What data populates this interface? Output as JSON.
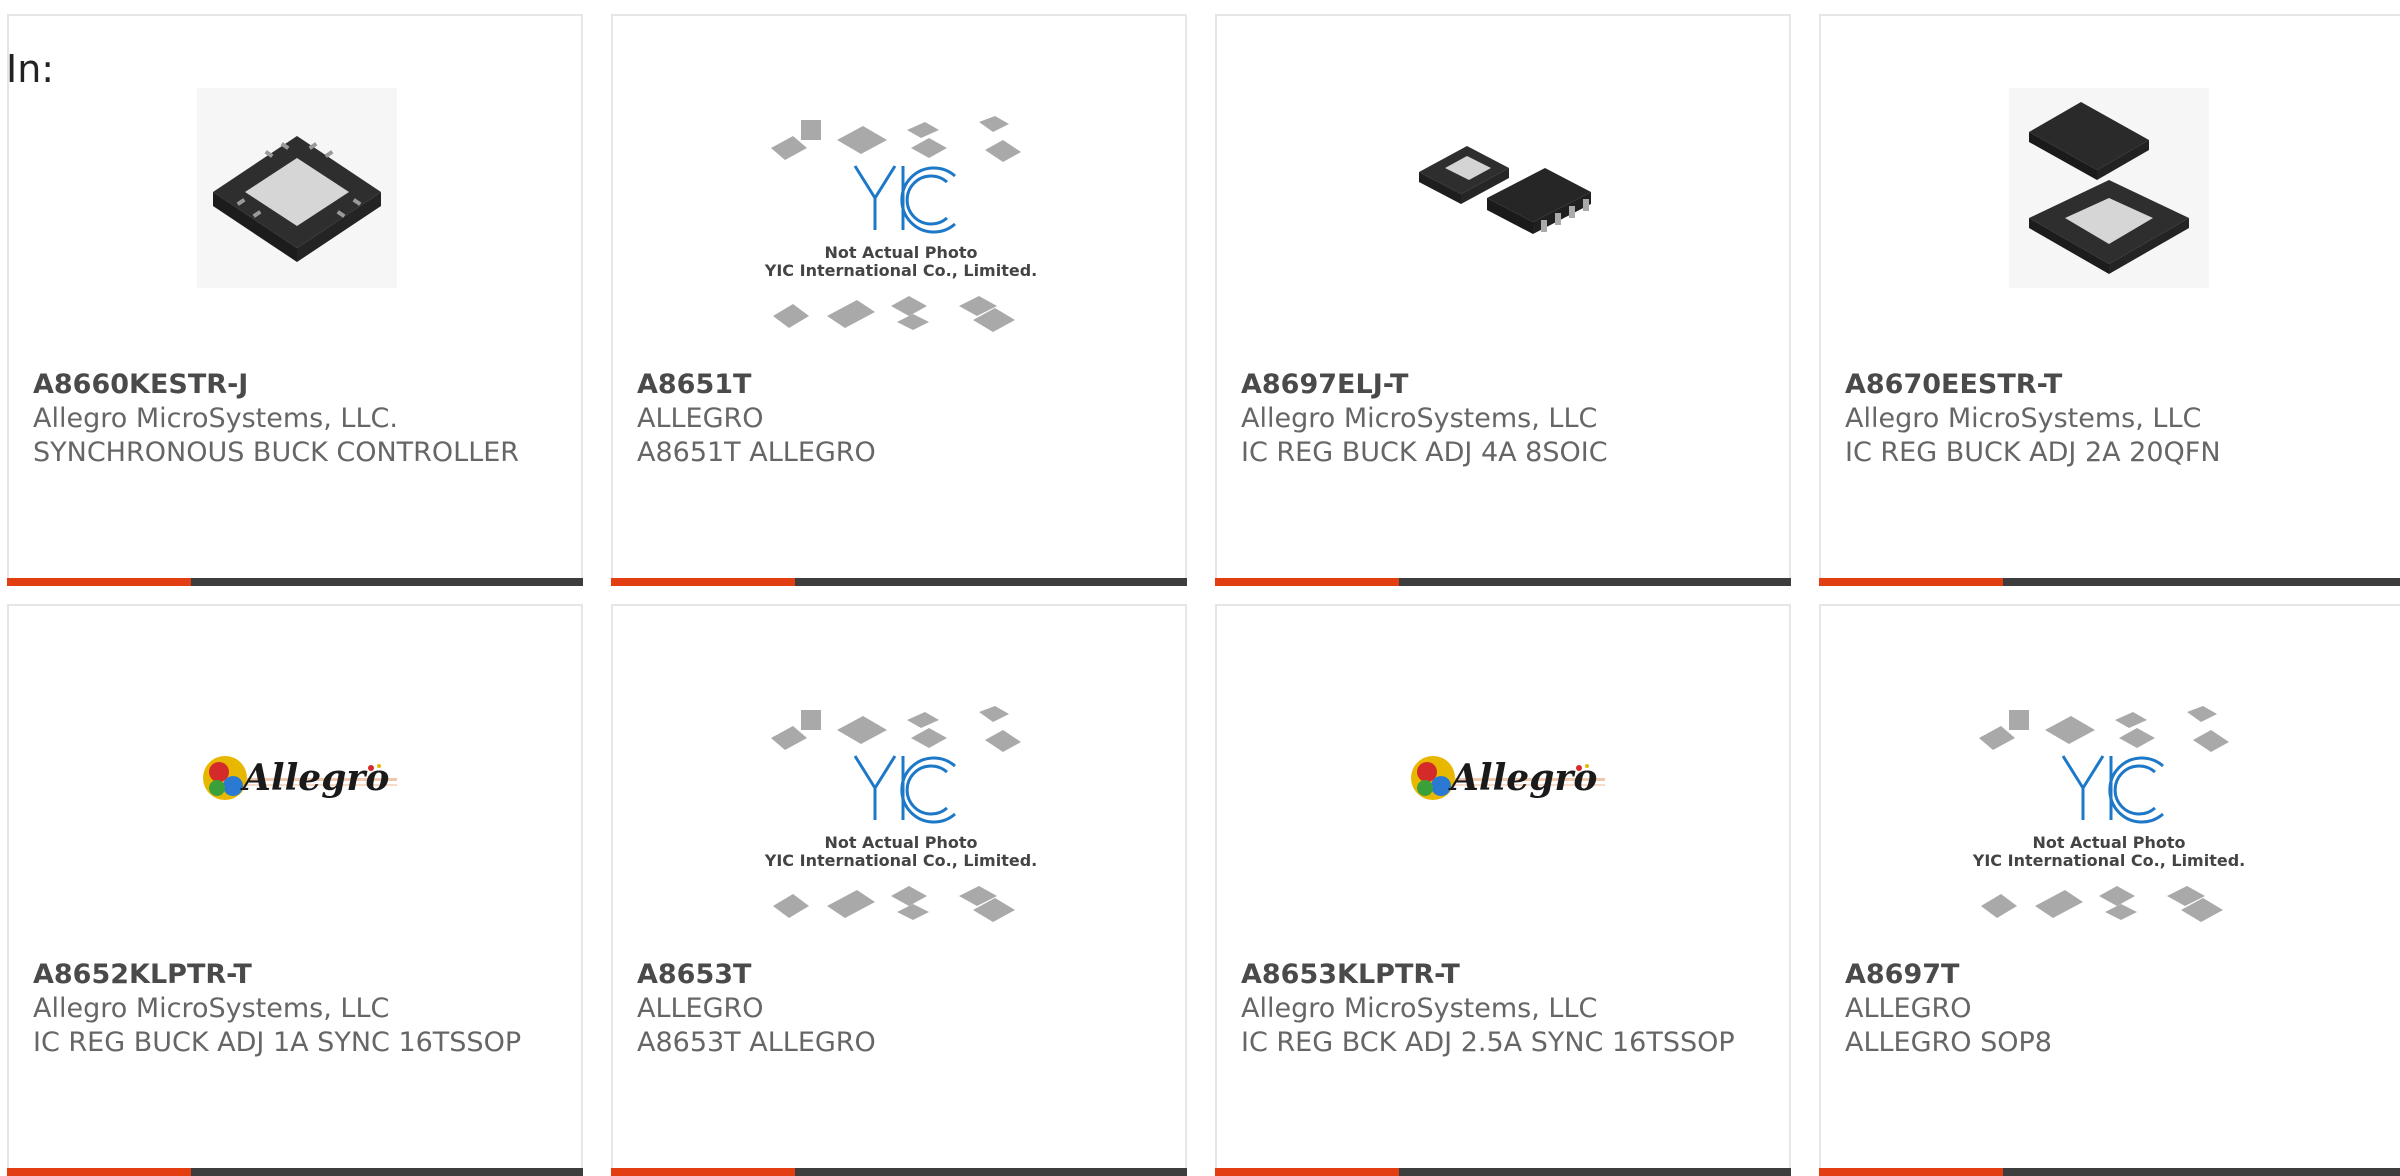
{
  "header": {
    "in_label": "In:"
  },
  "colors": {
    "accent": "#e33d12",
    "bar": "#3d3d3d"
  },
  "products": [
    {
      "part": "A8660KESTR-J",
      "maker": "Allegro MicroSystems, LLC.",
      "desc": "SYNCHRONOUS BUCK CONTROLLER",
      "image": "qfn-chip-icon"
    },
    {
      "part": "A8651T",
      "maker": "ALLEGRO",
      "desc": "A8651T ALLEGRO",
      "image": "not-actual-photo",
      "placeholder_line1": "Not Actual Photo",
      "placeholder_line2": "YIC International Co., Limited."
    },
    {
      "part": "A8697ELJ-T",
      "maker": "Allegro MicroSystems, LLC",
      "desc": "IC REG BUCK ADJ 4A 8SOIC",
      "image": "soic-chip-icon"
    },
    {
      "part": "A8670EESTR-T",
      "maker": "Allegro MicroSystems, LLC",
      "desc": "IC REG BUCK ADJ 2A 20QFN",
      "image": "qfn-pair-icon"
    },
    {
      "part": "A8652KLPTR-T",
      "maker": "Allegro MicroSystems, LLC",
      "desc": "IC REG BUCK ADJ 1A SYNC 16TSSOP",
      "image": "allegro-logo",
      "logo_text": "Allegro"
    },
    {
      "part": "A8653T",
      "maker": "ALLEGRO",
      "desc": "A8653T ALLEGRO",
      "image": "not-actual-photo",
      "placeholder_line1": "Not Actual Photo",
      "placeholder_line2": "YIC International Co., Limited."
    },
    {
      "part": "A8653KLPTR-T",
      "maker": "Allegro MicroSystems, LLC",
      "desc": "IC REG BCK ADJ 2.5A SYNC 16TSSOP",
      "image": "allegro-logo",
      "logo_text": "Allegro"
    },
    {
      "part": "A8697T",
      "maker": "ALLEGRO",
      "desc": "ALLEGRO SOP8",
      "image": "not-actual-photo",
      "placeholder_line1": "Not Actual Photo",
      "placeholder_line2": "YIC International Co., Limited."
    }
  ]
}
